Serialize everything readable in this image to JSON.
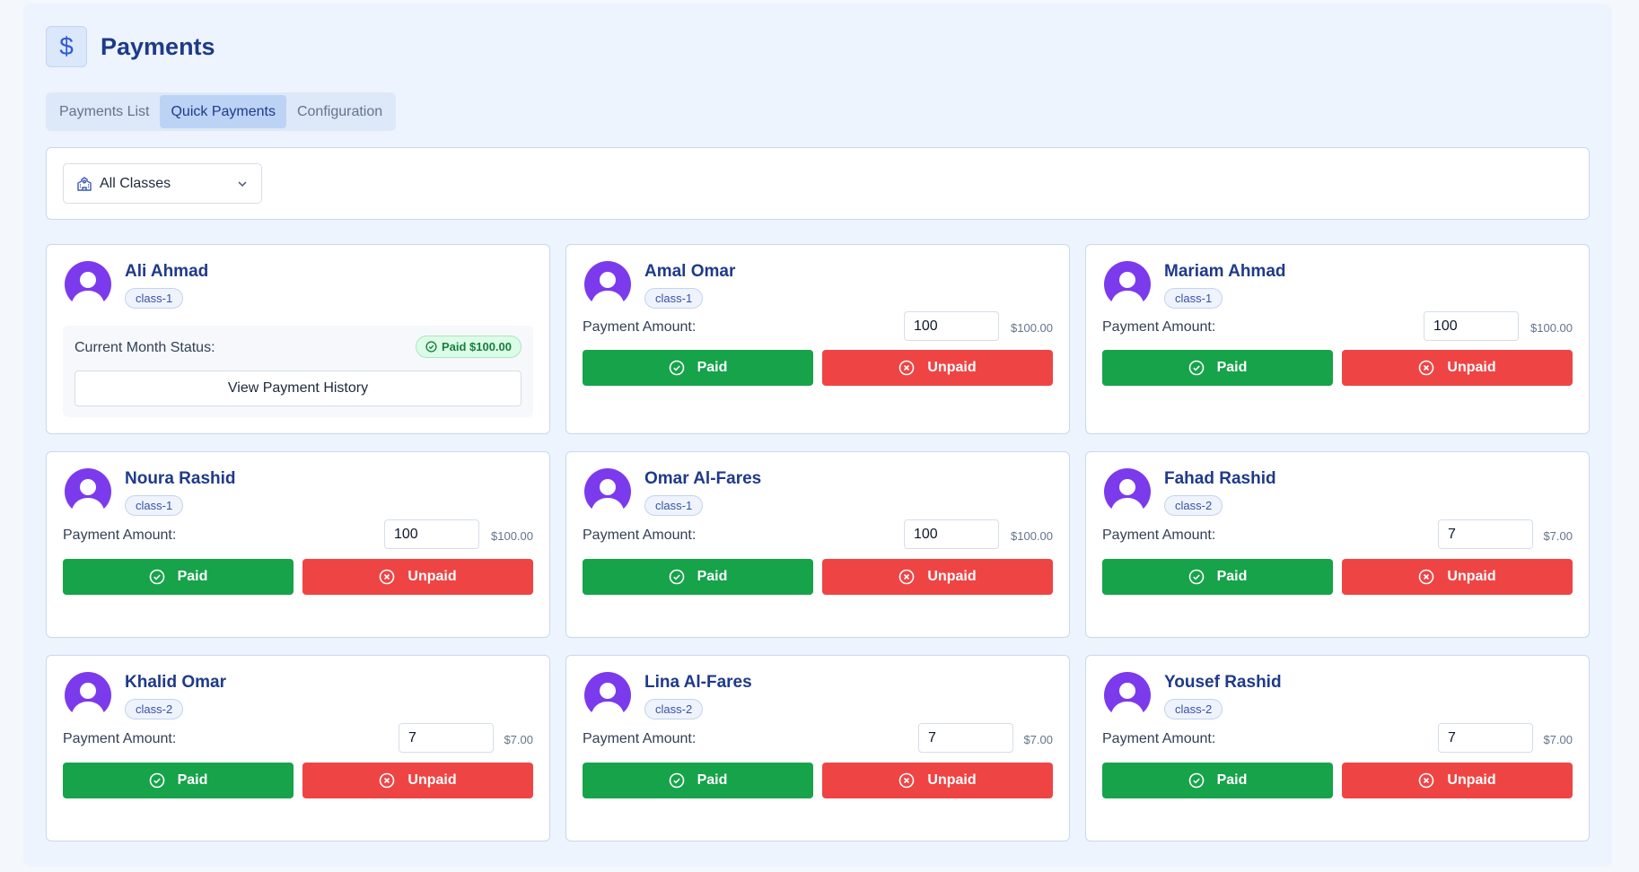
{
  "header": {
    "title": "Payments",
    "icon": "dollar-icon",
    "icon_glyph": "$"
  },
  "tabs": [
    {
      "label": "Payments List",
      "active": false
    },
    {
      "label": "Quick Payments",
      "active": true
    },
    {
      "label": "Configuration",
      "active": false
    }
  ],
  "filter": {
    "selected": "All Classes",
    "icon": "school-icon"
  },
  "labels": {
    "payment_amount": "Payment Amount:",
    "paid": "Paid",
    "unpaid": "Unpaid",
    "current_status": "Current Month Status:",
    "view_history": "View Payment History"
  },
  "colors": {
    "accent": "#1e3a8a",
    "paid": "#16a34a",
    "unpaid": "#ef4444",
    "avatar": "#7c3aed"
  },
  "students": [
    {
      "name": "Ali Ahmad",
      "class": "class-1",
      "status": "paid",
      "paid_badge": "Paid $100.00"
    },
    {
      "name": "Amal Omar",
      "class": "class-1",
      "amount": "100",
      "amount_display": "$100.00"
    },
    {
      "name": "Mariam Ahmad",
      "class": "class-1",
      "amount": "100",
      "amount_display": "$100.00"
    },
    {
      "name": "Noura Rashid",
      "class": "class-1",
      "amount": "100",
      "amount_display": "$100.00"
    },
    {
      "name": "Omar Al-Fares",
      "class": "class-1",
      "amount": "100",
      "amount_display": "$100.00"
    },
    {
      "name": "Fahad Rashid",
      "class": "class-2",
      "amount": "7",
      "amount_display": "$7.00"
    },
    {
      "name": "Khalid Omar",
      "class": "class-2",
      "amount": "7",
      "amount_display": "$7.00"
    },
    {
      "name": "Lina Al-Fares",
      "class": "class-2",
      "amount": "7",
      "amount_display": "$7.00"
    },
    {
      "name": "Yousef Rashid",
      "class": "class-2",
      "amount": "7",
      "amount_display": "$7.00"
    }
  ]
}
